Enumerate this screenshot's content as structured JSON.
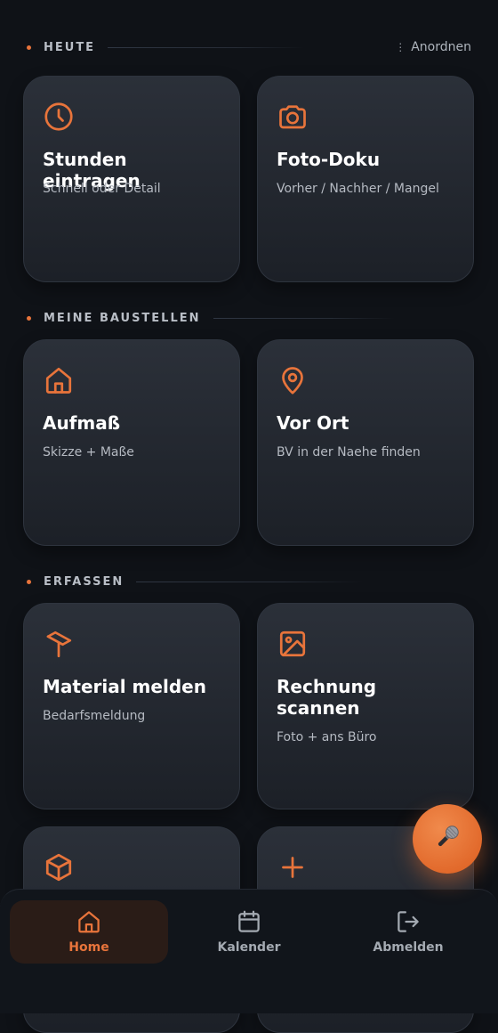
{
  "sections": {
    "today": {
      "title": "HEUTE",
      "arrange_label": "Anordnen"
    },
    "sites": {
      "title": "MEINE BAUSTELLEN"
    },
    "capture": {
      "title": "ERFASSEN"
    }
  },
  "cards": {
    "hours": {
      "title": "Stunden eintragen",
      "subtitle": "Schnell oder Detail",
      "icon": "clock-icon"
    },
    "photo": {
      "title": "Foto-Doku",
      "subtitle": "Vorher / Nachher / Mangel",
      "icon": "camera-icon"
    },
    "measure": {
      "title": "Aufmaß",
      "subtitle": "Skizze + Maße",
      "icon": "house-icon"
    },
    "onsite": {
      "title": "Vor Ort",
      "subtitle": "BV in der Naehe finden",
      "icon": "map-pin-icon"
    },
    "material": {
      "title": "Material melden",
      "subtitle": "Bedarfsmeldung",
      "icon": "paint-roller-icon"
    },
    "invoice": {
      "title": "Rechnung scannen",
      "subtitle": "Foto + ans Büro",
      "icon": "image-icon"
    },
    "box": {
      "icon": "package-icon"
    },
    "add": {
      "icon": "plus-icon"
    }
  },
  "fab": {
    "icon": "microphone-icon"
  },
  "nav": {
    "home": {
      "label": "Home",
      "icon": "home-icon"
    },
    "calendar": {
      "label": "Kalender",
      "icon": "calendar-icon"
    },
    "logout": {
      "label": "Abmelden",
      "icon": "logout-icon"
    }
  },
  "colors": {
    "accent": "#e8743b",
    "background": "#0f1217",
    "card": "#262b33"
  }
}
